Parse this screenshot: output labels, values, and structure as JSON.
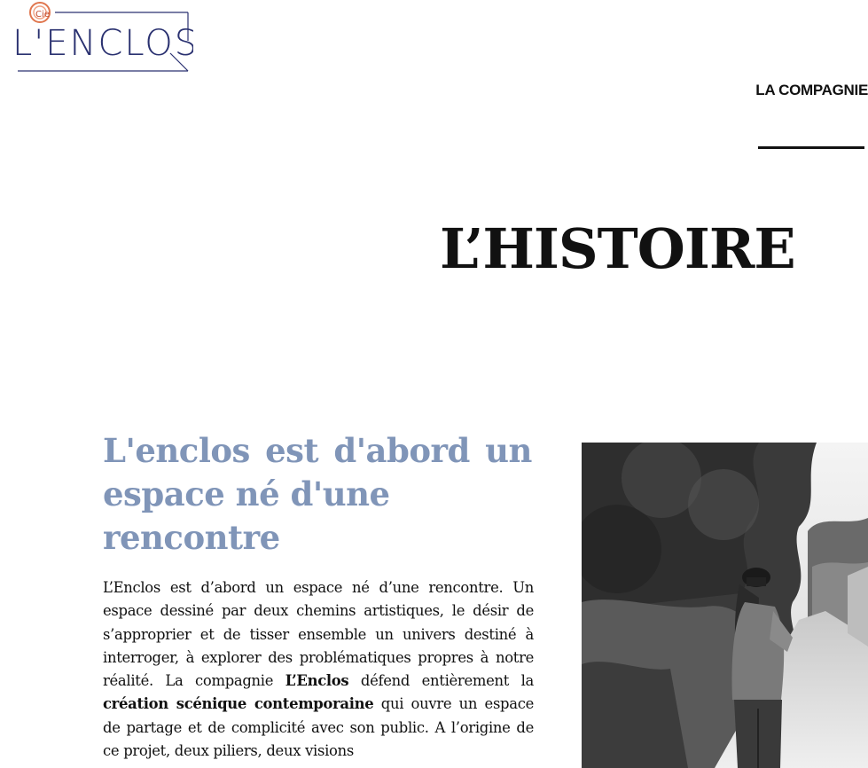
{
  "logo": {
    "prefix": "Cie",
    "name": "L'ENCLOS",
    "colors": {
      "ink": "#2a3170",
      "accent": "#e0764e"
    }
  },
  "nav": {
    "link_label": "LA COMPAGNIE"
  },
  "page": {
    "title": "L’HISTOIRE"
  },
  "section": {
    "heading_words_line1": [
      "L'enclos",
      "est",
      "d'abord",
      "un"
    ],
    "heading_line2": "espace né d'une",
    "heading_line3": "rencontre",
    "heading_color": "#8095b8",
    "body_parts": {
      "p1": "L’Enclos est d’abord un espace né d’une rencontre. Un espace dessiné par deux chemins artistiques, le désir de s’approprier et de tisser ensemble un univers destiné à interroger, à explorer des problématiques propres à notre réalité. La compagnie ",
      "b1": "L’Enclos",
      "p2": " défend entièrement la ",
      "b2": "création scénique contemporaine",
      "p3": " qui ouvre un espace de partage et de complicité avec son public. A l’origine de ce projet, deux piliers, deux visions"
    }
  },
  "photo": {
    "icon": "photo-woman-on-path",
    "tone": "black-and-white"
  }
}
